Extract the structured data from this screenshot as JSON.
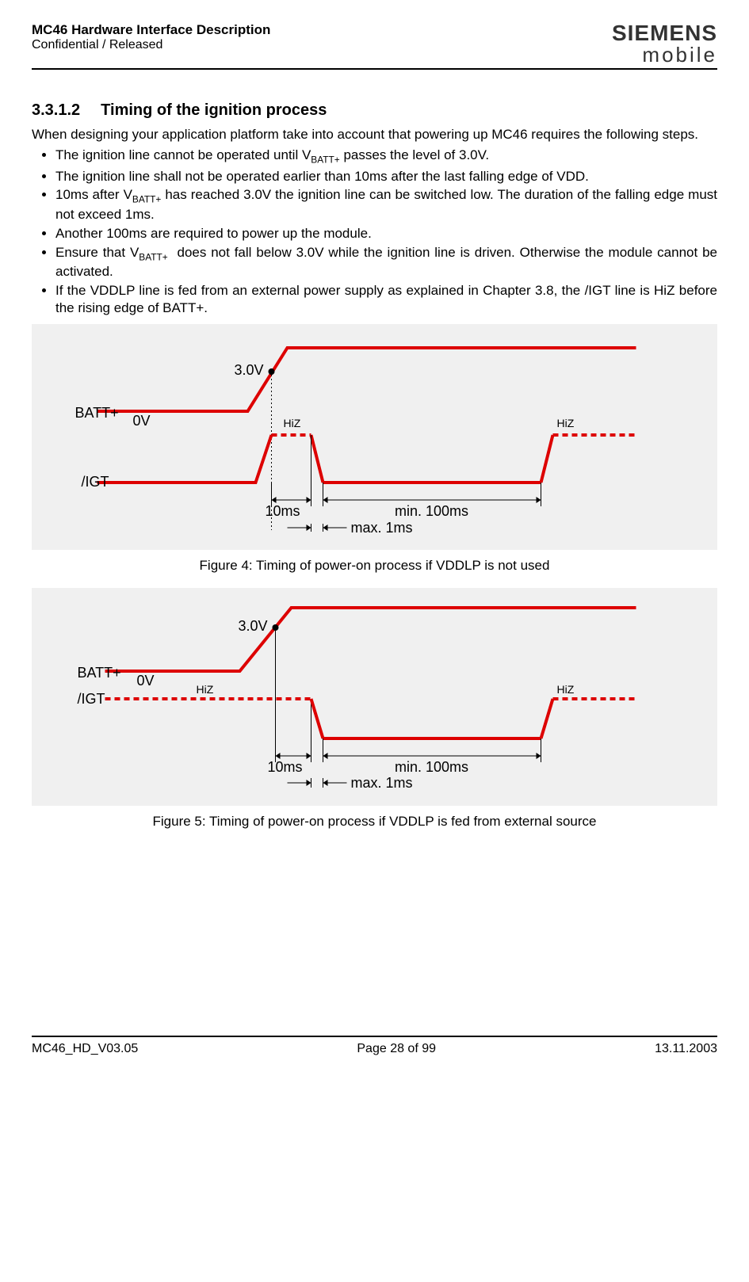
{
  "header": {
    "title": "MC46 Hardware Interface Description",
    "confidential": "Confidential / Released",
    "logo_top": "SIEMENS",
    "logo_bottom": "mobile"
  },
  "section": {
    "number": "3.3.1.2",
    "title": "Timing of the ignition process"
  },
  "intro": "When designing your application platform take into account that powering up MC46 requires the following steps.",
  "bullets": [
    "The ignition line cannot be operated until V{BATT+} passes the level of 3.0V.",
    "The ignition line shall not be operated earlier than 10ms after the last falling edge of VDD.",
    "10ms after V{BATT+} has reached 3.0V the ignition line can be switched low. The duration of the falling edge must not exceed 1ms.",
    "Another 100ms are required to power up the module.",
    "Ensure that V{BATT+}  does not fall below 3.0V while the ignition line is driven. Otherwise the module cannot be activated.",
    "If the VDDLP line is fed from an external power supply as explained in Chapter 3.8, the /IGT line is HiZ before the rising edge of BATT+."
  ],
  "fig1": {
    "label_batt": "BATT+",
    "label_0v": "0V",
    "label_3v": "3.0V",
    "label_igt": "/IGT",
    "label_hiz": "HiZ",
    "label_10ms": "10ms",
    "label_100ms": "min. 100ms",
    "label_max1ms": "max. 1ms",
    "caption": "Figure 4: Timing of power-on process if VDDLP is not used"
  },
  "fig2": {
    "label_batt": "BATT+",
    "label_0v": "0V",
    "label_3v": "3.0V",
    "label_igt": "/IGT",
    "label_hiz": "HiZ",
    "label_10ms": "10ms",
    "label_100ms": "min. 100ms",
    "label_max1ms": "max. 1ms",
    "caption": "Figure 5: Timing of power-on process if VDDLP is fed from external source"
  },
  "footer": {
    "left": "MC46_HD_V03.05",
    "center": "Page 28 of 99",
    "right": "13.11.2003"
  },
  "chart_data": [
    {
      "type": "timing-diagram",
      "title": "Timing of power-on process if VDDLP is not used",
      "signals": [
        {
          "name": "BATT+",
          "levels": [
            "0V",
            "3.0V"
          ],
          "event": "rises from 0V past 3.0V"
        },
        {
          "name": "/IGT",
          "segments": [
            "low",
            "HiZ (10ms after BATT+ crosses 3.0V)",
            "falling edge max 1ms",
            "low for min 100ms",
            "HiZ"
          ]
        }
      ],
      "timing": {
        "hiz_delay_after_3v": "10ms",
        "falling_edge_max": "1ms",
        "low_pulse_min": "100ms"
      }
    },
    {
      "type": "timing-diagram",
      "title": "Timing of power-on process if VDDLP is fed from external source",
      "signals": [
        {
          "name": "BATT+",
          "levels": [
            "0V",
            "3.0V"
          ],
          "event": "rises from 0V past 3.0V"
        },
        {
          "name": "/IGT",
          "segments": [
            "HiZ until 10ms after BATT+ crosses 3.0V",
            "falling edge max 1ms",
            "low for min 100ms",
            "HiZ"
          ]
        }
      ],
      "timing": {
        "hiz_delay_after_3v": "10ms",
        "falling_edge_max": "1ms",
        "low_pulse_min": "100ms"
      }
    }
  ]
}
